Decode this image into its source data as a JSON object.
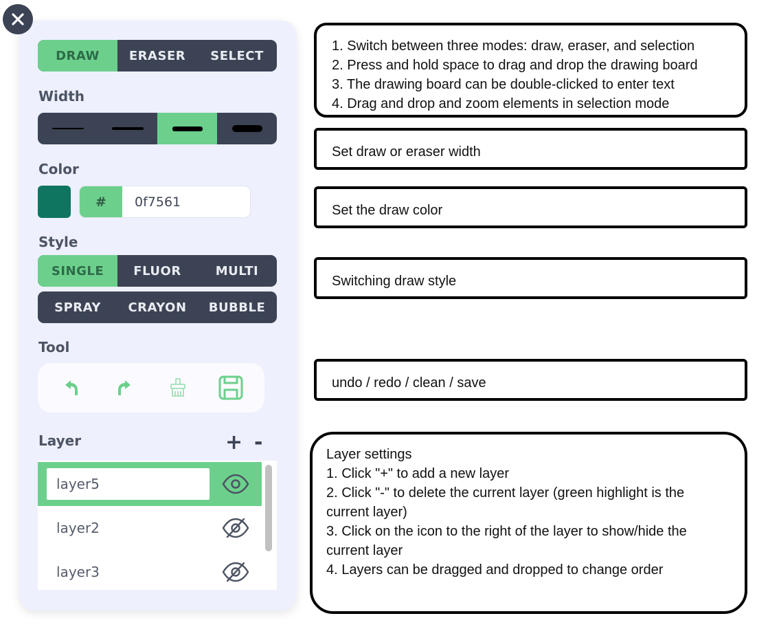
{
  "modes": {
    "items": [
      "DRAW",
      "ERASER",
      "SELECT"
    ],
    "active": "DRAW"
  },
  "width": {
    "label": "Width",
    "options": [
      "thin",
      "medium",
      "thick",
      "extra-thick"
    ],
    "active_index": 2
  },
  "color": {
    "label": "Color",
    "hash_label": "#",
    "value": "0f7561",
    "swatch": "#0f7561"
  },
  "style": {
    "label": "Style",
    "row1": [
      "SINGLE",
      "FLUOR",
      "MULTI"
    ],
    "row2": [
      "SPRAY",
      "CRAYON",
      "BUBBLE"
    ],
    "active": "SINGLE"
  },
  "tool": {
    "label": "Tool",
    "items": [
      "undo-icon",
      "redo-icon",
      "clean-icon",
      "save-icon"
    ]
  },
  "layer": {
    "label": "Layer",
    "add": "+",
    "remove": "-",
    "items": [
      {
        "name": "layer5",
        "visible": true,
        "active": true
      },
      {
        "name": "layer2",
        "visible": false,
        "active": false
      },
      {
        "name": "layer3",
        "visible": false,
        "active": false
      }
    ]
  },
  "notes": {
    "modes": [
      "1. Switch between three modes: draw, eraser, and selection",
      "2. Press and hold space to drag and drop the drawing board",
      "3. The drawing board can be double-clicked to enter text",
      "4. Drag and drop and zoom elements in selection mode"
    ],
    "width": "Set draw or eraser width",
    "color": "Set the draw color",
    "style": "Switching draw style",
    "tool": "undo / redo / clean / save",
    "layer": [
      "Layer settings",
      "1. Click \"+\" to add a new layer",
      "2. Click \"-\" to delete the current layer (green highlight is the",
      "current layer)",
      "3. Click on the icon to the right of the layer to show/hide the",
      "current layer",
      "4. Layers can be dragged and dropped to change order"
    ]
  },
  "colors": {
    "accent": "#6cd08c",
    "dark": "#3b4354",
    "panel": "#eef0fd"
  }
}
